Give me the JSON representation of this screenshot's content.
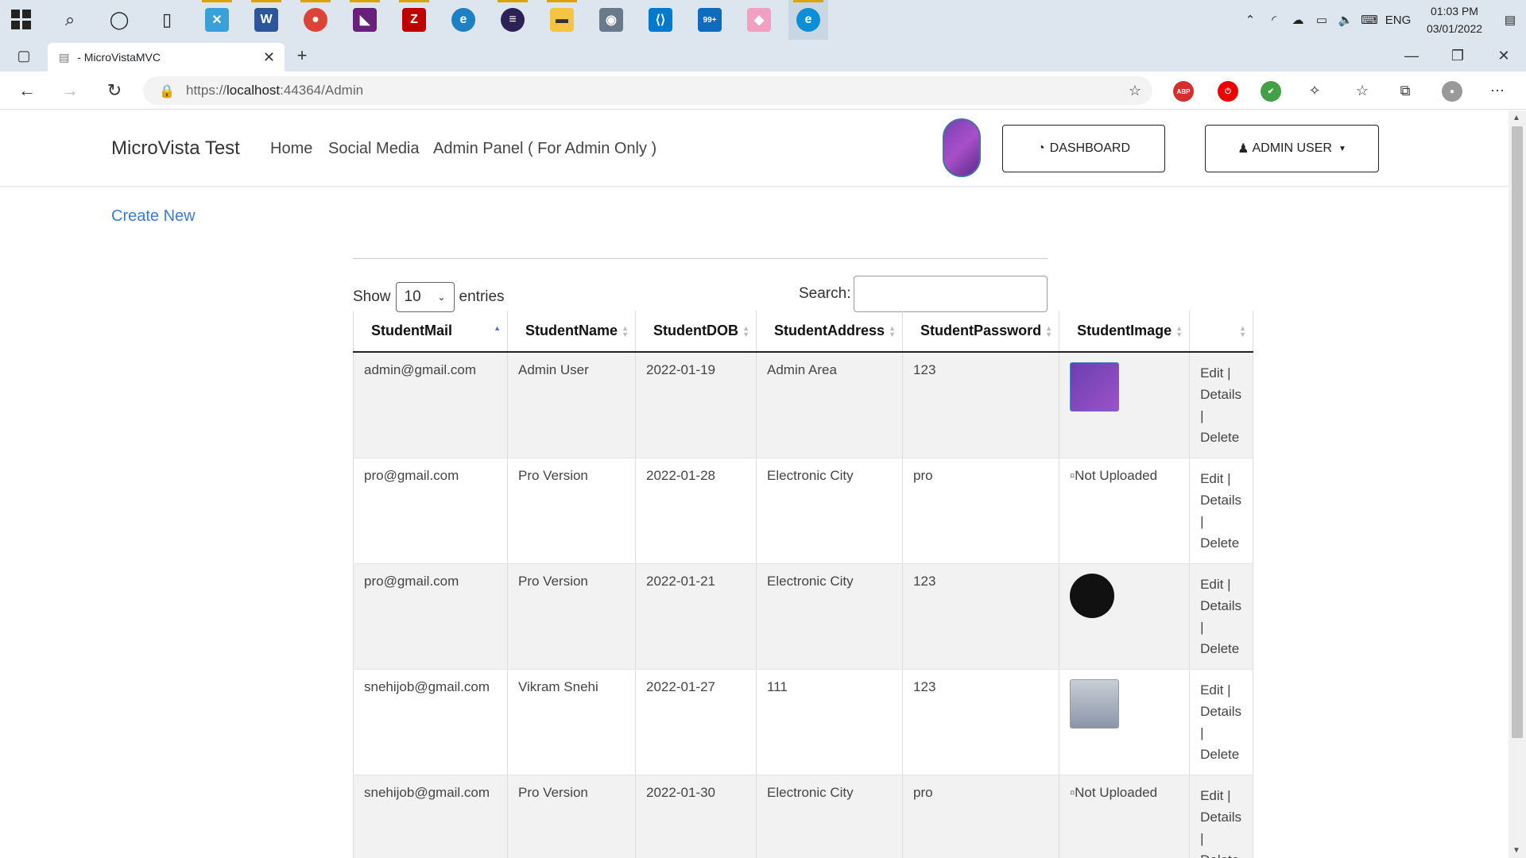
{
  "taskbar": {
    "clock_time": "01:03 PM",
    "clock_date": "03/01/2022",
    "language": "ENG",
    "mail_badge": "99+"
  },
  "browser": {
    "tab_title": "- MicroVistaMVC",
    "url_prefix": "https://",
    "url_host": "localhost",
    "url_rest": ":44364/Admin",
    "abp_label": "ABP"
  },
  "navbar": {
    "brand": "MicroVista Test",
    "links": [
      "Home",
      "Social Media",
      "Admin Panel ( For Admin Only )"
    ],
    "dashboard_label": "DASHBOARD",
    "user_label": "ADMIN USER"
  },
  "main": {
    "create_new": "Create New",
    "show_label": "Show",
    "entries_label": "entries",
    "page_size": "10",
    "search_label": "Search:"
  },
  "table": {
    "headers": [
      "StudentMail",
      "StudentName",
      "StudentDOB",
      "StudentAddress",
      "StudentPassword",
      "StudentImage",
      ""
    ],
    "rows": [
      {
        "mail": "admin@gmail.com",
        "name": "Admin User",
        "dob": "2022-01-19",
        "address": "Admin Area",
        "password": "123",
        "image": "course-cover",
        "image_alt": ""
      },
      {
        "mail": "pro@gmail.com",
        "name": "Pro Version",
        "dob": "2022-01-28",
        "address": "Electronic City",
        "password": "pro",
        "image": "missing",
        "image_alt": "Not Uploaded"
      },
      {
        "mail": "pro@gmail.com",
        "name": "Pro Version",
        "dob": "2022-01-21",
        "address": "Electronic City",
        "password": "123",
        "image": "code-badge",
        "image_alt": ""
      },
      {
        "mail": "snehijob@gmail.com",
        "name": "Vikram Snehi",
        "dob": "2022-01-27",
        "address": "111",
        "password": "123",
        "image": "photo",
        "image_alt": ""
      },
      {
        "mail": "snehijob@gmail.com",
        "name": "Pro Version",
        "dob": "2022-01-30",
        "address": "Electronic City",
        "password": "pro",
        "image": "missing",
        "image_alt": "Not Uploaded"
      }
    ],
    "action_edit": "Edit |",
    "action_details": "Details",
    "action_sep": "|",
    "action_delete": "Delete"
  },
  "colors": {
    "link": "#3a7bd5",
    "taskbar": "#dde6ef",
    "sort_active": "#4a72c8"
  }
}
